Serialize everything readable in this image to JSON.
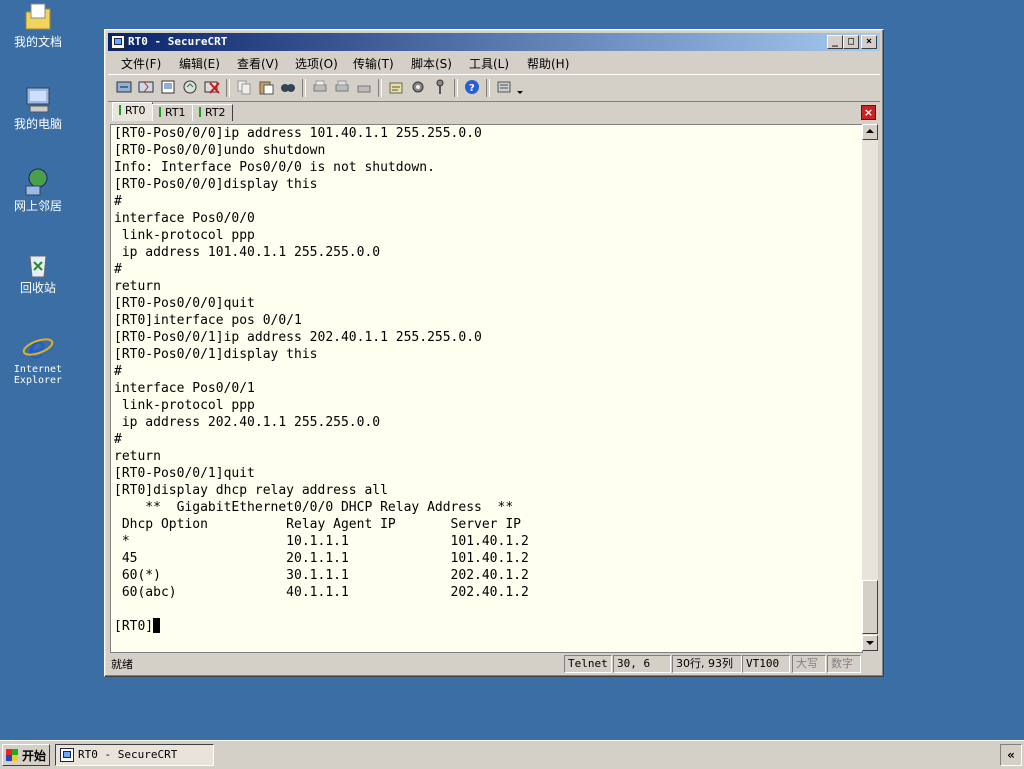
{
  "desktop": {
    "icons": [
      {
        "label": "我的文档"
      },
      {
        "label": "我的电脑"
      },
      {
        "label": "网上邻居"
      },
      {
        "label": "回收站"
      },
      {
        "label_line1": "Internet",
        "label_line2": "Explorer"
      }
    ]
  },
  "window": {
    "title": "RT0 - SecureCRT",
    "controls": {
      "minimize": "_",
      "maximize": "□",
      "close": "×"
    },
    "menu": [
      "文件(F)",
      "编辑(E)",
      "查看(V)",
      "选项(O)",
      "传输(T)",
      "脚本(S)",
      "工具(L)",
      "帮助(H)"
    ],
    "tabs": [
      "RT0",
      "RT1",
      "RT2"
    ],
    "tab_close": "×",
    "terminal_lines": [
      "[RT0-Pos0/0/0]ip address 101.40.1.1 255.255.0.0",
      "[RT0-Pos0/0/0]undo shutdown",
      "Info: Interface Pos0/0/0 is not shutdown.",
      "[RT0-Pos0/0/0]display this",
      "#",
      "interface Pos0/0/0",
      " link-protocol ppp",
      " ip address 101.40.1.1 255.255.0.0",
      "#",
      "return",
      "[RT0-Pos0/0/0]quit",
      "[RT0]interface pos 0/0/1",
      "[RT0-Pos0/0/1]ip address 202.40.1.1 255.255.0.0",
      "[RT0-Pos0/0/1]display this",
      "#",
      "interface Pos0/0/1",
      " link-protocol ppp",
      " ip address 202.40.1.1 255.255.0.0",
      "#",
      "return",
      "[RT0-Pos0/0/1]quit",
      "[RT0]display dhcp relay address all",
      "    **  GigabitEthernet0/0/0 DHCP Relay Address  **",
      " Dhcp Option          Relay Agent IP       Server IP",
      " *                    10.1.1.1             101.40.1.2",
      " 45                   20.1.1.1             101.40.1.2",
      " 60(*)                30.1.1.1             202.40.1.2",
      " 60(abc)              40.1.1.1             202.40.1.2",
      ""
    ],
    "prompt": "[RT0]",
    "status": {
      "ready": "就绪",
      "protocol": "Telnet",
      "cursor_pos": "30,   6",
      "rows_cols": "30行, 93列",
      "term_type": "VT100",
      "caps": "大写",
      "num": "数字"
    }
  },
  "taskbar": {
    "start_label": "开始",
    "task_label": "RT0 - SecureCRT",
    "tray_label": "«"
  }
}
